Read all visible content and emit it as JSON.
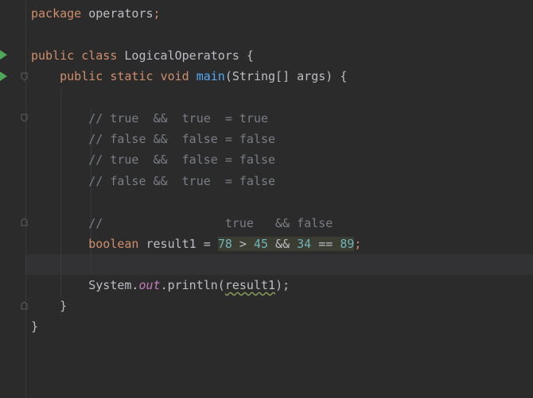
{
  "editor": {
    "lines": {
      "l1": {
        "kw": "package",
        "rest": " operators",
        "semi": ";"
      },
      "l3": {
        "kw1": "public",
        "kw2": "class",
        "name": " LogicalOperators {"
      },
      "l4": {
        "kw1": "public",
        "kw2": "static",
        "kw3": "void",
        "fn": "main",
        "rest": "(String[] args) {"
      },
      "c1": "// true  &&  true  = true",
      "c2": "// false &&  false = false",
      "c3": "// true  &&  false = false",
      "c4": "// false &&  true  = false",
      "c5": "//                 true   && false",
      "l10": {
        "kw": "boolean",
        "var": " result1 = ",
        "n1": "78",
        "op1": " > ",
        "n2": "45",
        "op2": " && ",
        "n3": "34",
        "op3": " == ",
        "n4": "89",
        "semi": ";"
      },
      "l12": {
        "cls": "System.",
        "field": "out",
        "call": ".println(",
        "arg": "result1",
        "end": ");"
      },
      "close1": "}",
      "close2": "}"
    }
  },
  "colors": {
    "background": "#2b2b2c",
    "keyword": "#cf8e6d",
    "comment": "#7a7e85",
    "number": "#2aacb8",
    "method": "#56a8f5",
    "static_field": "#c77dbb",
    "run_icon": "#4fa85a"
  },
  "icons": [
    "run-gutter-icon",
    "fold-icon"
  ]
}
